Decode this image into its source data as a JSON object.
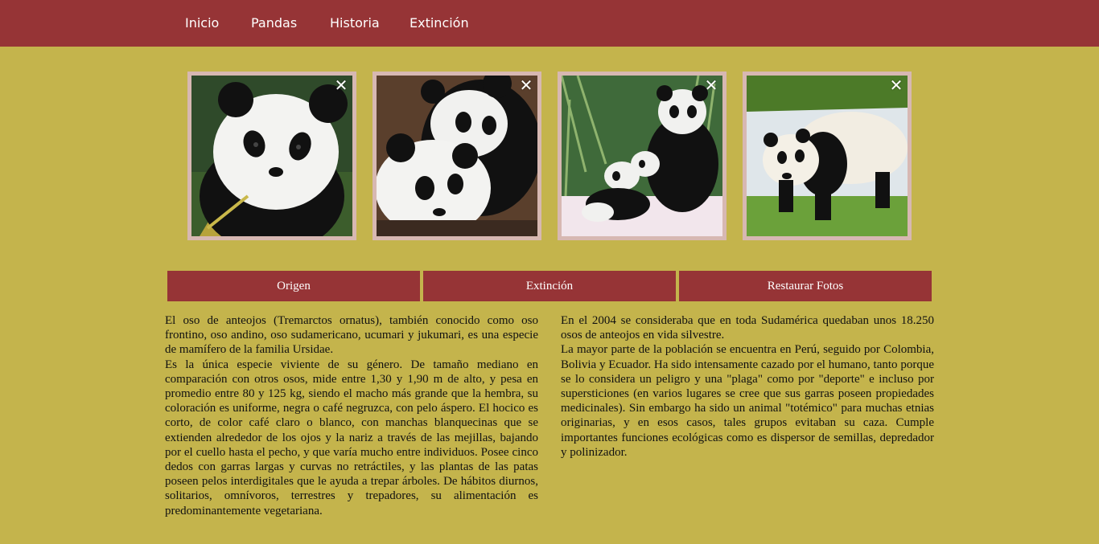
{
  "nav": {
    "items": [
      "Inicio",
      "Pandas",
      "Historia",
      "Extinción"
    ]
  },
  "gallery": {
    "close_glyph": "✕",
    "photos": [
      {
        "icon": "panda-photo-1",
        "description": "panda portrait"
      },
      {
        "icon": "panda-photo-2",
        "description": "two pandas"
      },
      {
        "icon": "panda-photo-3",
        "description": "panda with cubs"
      },
      {
        "icon": "panda-photo-4",
        "description": "panda on grass"
      }
    ]
  },
  "buttons": {
    "origen": "Origen",
    "extincion": "Extinción",
    "restaurar": "Restaurar Fotos"
  },
  "content": {
    "left": [
      "El oso de anteojos (Tremarctos ornatus), también conocido como oso frontino, oso andino, oso sudamericano, ucumari y jukumari, es una especie de mamífero de la familia Ursidae.",
      "Es la única especie viviente de su género. De tamaño mediano en comparación con otros osos, mide entre 1,30 y 1,90 m de alto, y pesa en promedio entre 80 y 125 kg, siendo el macho más grande que la hembra, su coloración es uniforme, negra o café negruzca, con pelo áspero. El hocico es corto, de color café claro o blanco, con manchas blanquecinas que se extienden alrededor de los ojos y la nariz a través de las mejillas, bajando por el cuello hasta el pecho, y que varía mucho entre individuos. Posee cinco dedos con garras largas y curvas no retráctiles, y las plantas de las patas poseen pelos interdigitales que le ayuda a trepar árboles. De hábitos diurnos, solitarios, omnívoros, terrestres y trepadores, su alimentación es predominantemente vegetariana."
    ],
    "right": [
      "En el 2004 se consideraba que en toda Sudamérica quedaban unos 18.250 osos de anteojos en vida silvestre.",
      "La mayor parte de la población se encuentra en Perú, seguido por Colombia, Bolivia y Ecuador. Ha sido intensamente cazado por el humano, tanto porque se lo considera un peligro y una \"plaga\" como por \"deporte\" e incluso por supersticiones (en varios lugares se cree que sus garras poseen propiedades medicinales). Sin embargo ha sido un animal \"totémico\" para muchas etnias originarias, y en esos casos, tales grupos evitaban su caza. Cumple importantes funciones ecológicas como es dispersor de semillas, depredador y polinizador."
    ]
  },
  "colors": {
    "background": "#c4b44c",
    "nav_bg": "#963436",
    "button_bg": "#963436",
    "photo_border": "#d7b8b2"
  }
}
